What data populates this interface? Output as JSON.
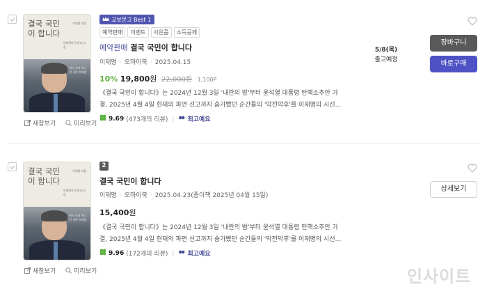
{
  "items": [
    {
      "badge_best": "교보문고 Best 1",
      "tags": [
        "예약판매",
        "이벤트",
        "사은품",
        "소득공제"
      ],
      "title_prefix": "예약판매",
      "title": "결국 국민이 합니다",
      "author": "이재명",
      "publisher": "오마이북",
      "date": "2025.04.15",
      "discount": "10%",
      "price": "19,800",
      "won": "원",
      "original_price": "22,000원",
      "point": "1,100P",
      "description_line1": "《결국 국민이 합니다》는 2024년 12월 3일 '내란의 밤'부터 윤석열 대통령 탄핵소추안 가",
      "description_line2": "결, 2025년 4월 4일 현재의 파면 선고까지 숨가빴던 순간들의 '막전막후'를 이재명의 시선...",
      "rating_score": "9.69",
      "rating_count": "(473개의 리뷰)",
      "emotion_label": "최고예요",
      "delivery_date": "5/8(목)",
      "delivery_status": "출고예정",
      "cart_label": "장바구니",
      "buy_label": "바로구매",
      "preview_new": "새창보기",
      "preview_look": "미리보기",
      "cover": {
        "title": "결국 국민이 합니다",
        "author": "이재명 지음",
        "subtitle": "이재명의 민생과 성장",
        "photo_text": "위기 속의 하나 된 국민 이재명"
      }
    },
    {
      "rank": "2",
      "title": "결국 국민이 합니다",
      "author": "이재명",
      "publisher": "오마이북",
      "date": "2025.04.23(종이책 2025년 04월 15일)",
      "price": "15,400",
      "won": "원",
      "description_line1": "《결국 국민이 합니다》는 2024년 12월 3일 '내란의 밤'부터 윤석열 대통령 탄핵소추안 가",
      "description_line2": "결, 2025년 4월 4일 현재의 파면 선고까지 숨가빴던 순간들의 '막전막후'를 이재명의 시선...",
      "rating_score": "9.96",
      "rating_count": "(172개의 리뷰)",
      "emotion_label": "최고예요",
      "detail_label": "상세보기",
      "preview_new": "새창보기",
      "preview_look": "미리보기",
      "cover": {
        "title": "결국 국민이 합니다",
        "author": "이재명 지음",
        "subtitle": "이재명의 민생과 성장",
        "photo_text": "위기 속의 하나 된 국민 이재명"
      }
    }
  ],
  "watermark": "인사이트",
  "colors": {
    "accent_purple": "#474c98",
    "buy_button": "#4f52c4",
    "discount_green": "#5cb33c",
    "dark_button": "#595959"
  }
}
